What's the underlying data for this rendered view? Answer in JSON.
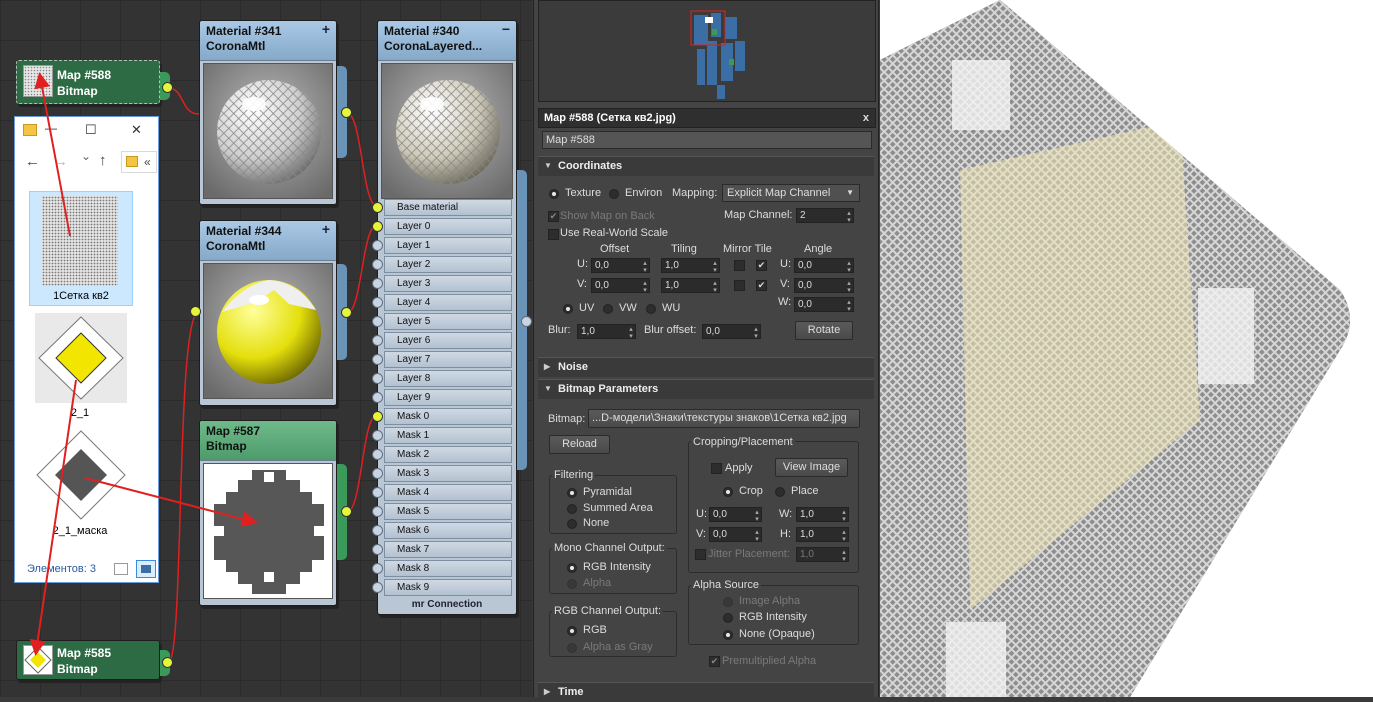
{
  "node_editor": {
    "nodes": {
      "map588": {
        "title": "Map #588",
        "subtitle": "Bitmap"
      },
      "mat341": {
        "title": "Material #341",
        "subtitle": "CoronaMtl"
      },
      "mat340": {
        "title": "Material #340",
        "subtitle": "CoronaLayered..."
      },
      "mat344": {
        "title": "Material #344",
        "subtitle": "CoronaMtl"
      },
      "map587": {
        "title": "Map #587",
        "subtitle": "Bitmap"
      },
      "map585": {
        "title": "Map #585",
        "subtitle": "Bitmap"
      }
    },
    "layered_slots": [
      "Base material",
      "Layer 0",
      "Layer 1",
      "Layer 2",
      "Layer 3",
      "Layer 4",
      "Layer 5",
      "Layer 6",
      "Layer 7",
      "Layer 8",
      "Layer 9",
      "Mask 0",
      "Mask 1",
      "Mask 2",
      "Mask 3",
      "Mask 4",
      "Mask 5",
      "Mask 6",
      "Mask 7",
      "Mask 8",
      "Mask 9"
    ],
    "layered_footer": "mr Connection",
    "plus_sign": "+",
    "minus_sign": "−"
  },
  "explorer": {
    "back_icon": "←",
    "forward_icon": "→",
    "dropdown_icon": "⌄",
    "up_icon": "↑",
    "path_chevron": "«",
    "minimize_icon": "—",
    "maximize_icon": "☐",
    "close_icon": "✕",
    "items": [
      {
        "label": "1Сетка кв2"
      },
      {
        "label": "2_1"
      },
      {
        "label": "2_1_маска"
      }
    ],
    "status": "Элементов: 3"
  },
  "panel": {
    "title": "Map #588  (Сетка кв2.jpg)",
    "close_icon": "x",
    "name_field": "Map #588",
    "coordinates": {
      "header": "Coordinates",
      "texture": "Texture",
      "environ": "Environ",
      "mapping_label": "Mapping:",
      "mapping_value": "Explicit Map Channel",
      "show_map_on_back": "Show Map on Back",
      "map_channel_label": "Map Channel:",
      "map_channel_value": "2",
      "use_real_world": "Use Real-World Scale",
      "col_offset": "Offset",
      "col_tiling": "Tiling",
      "col_mirror_tile": "Mirror Tile",
      "col_angle": "Angle",
      "u_label": "U:",
      "v_label": "V:",
      "w_label": "W:",
      "u_offset": "0,0",
      "v_offset": "0,0",
      "u_tiling": "1,0",
      "v_tiling": "1,0",
      "u_angle": "0,0",
      "v_angle": "0,0",
      "w_angle": "0,0",
      "uv": "UV",
      "vw": "VW",
      "wu": "WU",
      "blur_label": "Blur:",
      "blur_value": "1,0",
      "blur_offset_label": "Blur offset:",
      "blur_offset_value": "0,0",
      "rotate": "Rotate",
      "check_mark": "✔"
    },
    "noise": {
      "header": "Noise"
    },
    "bitmap_params": {
      "header": "Bitmap Parameters",
      "bitmap_label": "Bitmap:",
      "bitmap_path": "...D-модели\\Знаки\\текстуры знаков\\1Сетка кв2.jpg",
      "reload": "Reload",
      "cropping_title": "Cropping/Placement",
      "apply": "Apply",
      "view_image": "View Image",
      "crop": "Crop",
      "place": "Place",
      "u_label": "U:",
      "v_label": "V:",
      "w_label": "W:",
      "h_label": "H:",
      "crop_u": "0,0",
      "crop_v": "0,0",
      "crop_w": "1,0",
      "crop_h": "1,0",
      "jitter_label": "Jitter Placement:",
      "jitter_value": "1,0",
      "filtering_title": "Filtering",
      "pyramidal": "Pyramidal",
      "summed_area": "Summed Area",
      "none": "None",
      "mono_title": "Mono Channel Output:",
      "rgb_intensity": "RGB Intensity",
      "alpha": "Alpha",
      "rgb_title": "RGB Channel Output:",
      "rgb": "RGB",
      "alpha_as_gray": "Alpha as Gray",
      "alpha_source_title": "Alpha Source",
      "image_alpha": "Image Alpha",
      "alpha_rgb_intensity": "RGB Intensity",
      "none_opaque": "None (Opaque)",
      "premultiplied": "Premultiplied Alpha"
    },
    "time": {
      "header": "Time"
    }
  },
  "colors": {
    "link": "#e02020",
    "socket": "#e5f53a",
    "yellow": "#f2e600"
  }
}
